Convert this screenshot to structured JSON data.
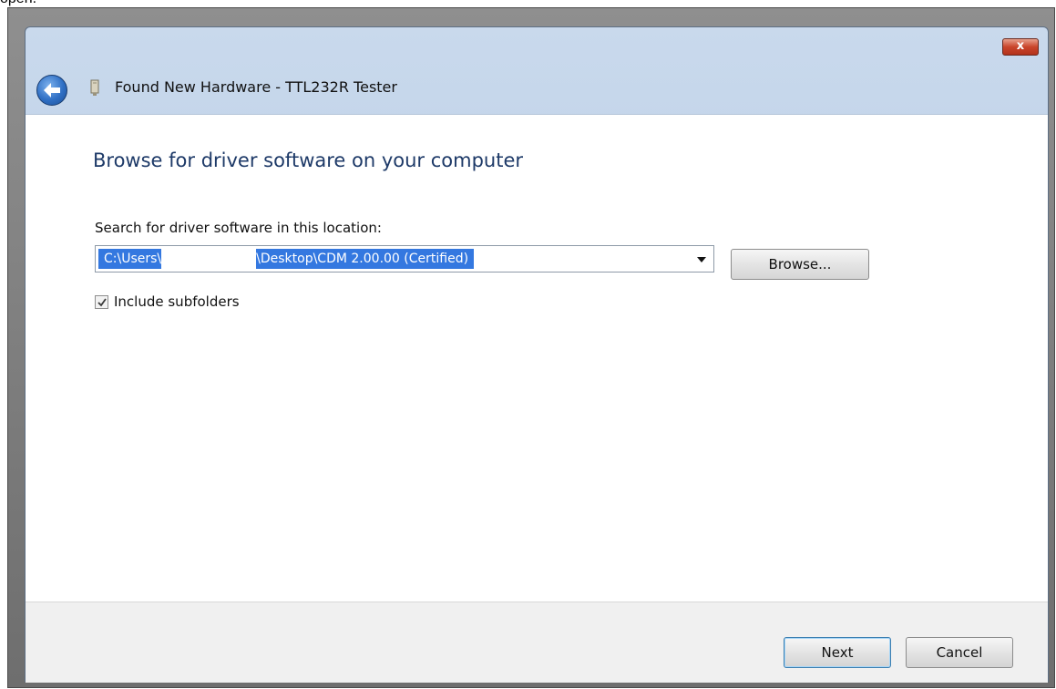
{
  "caption": "open.",
  "window": {
    "title": "Found New Hardware - TTL232R Tester",
    "close_label": "x"
  },
  "content": {
    "heading": "Browse for driver software on your computer",
    "search_label": "Search for driver software in this location:",
    "path_prefix": "C:\\Users\\",
    "path_suffix": "\\Desktop\\CDM 2.00.00 (Certified)",
    "browse_label": "Browse...",
    "include_subfolders_label": "Include subfolders",
    "include_subfolders_checked": true
  },
  "footer": {
    "next_label": "Next",
    "cancel_label": "Cancel"
  },
  "icons": {
    "back": "back-arrow-icon",
    "hardware": "hardware-device-icon",
    "close": "close-icon",
    "dropdown": "chevron-down-icon",
    "check": "checkmark-icon"
  }
}
